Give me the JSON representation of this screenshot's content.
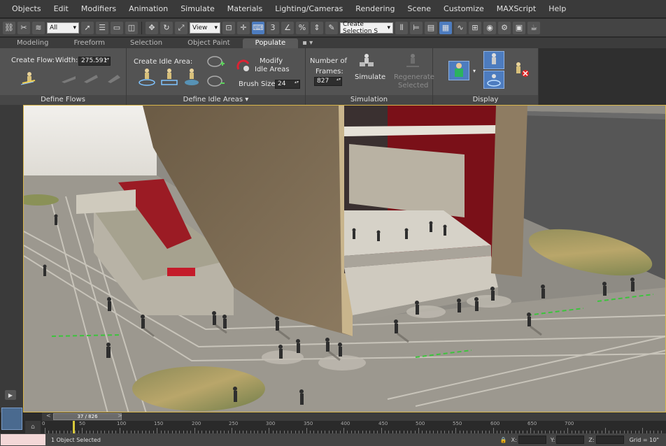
{
  "menu": [
    "Objects",
    "Edit",
    "Modifiers",
    "Animation",
    "Simulate",
    "Materials",
    "Lighting/Cameras",
    "Rendering",
    "Scene",
    "Customize",
    "MAXScript",
    "Help"
  ],
  "toolbar": {
    "filter_select": "All",
    "view_select": "View",
    "selection_set": "Create Selection S"
  },
  "ribbon_tabs": [
    "Modeling",
    "Freeform",
    "Selection",
    "Object Paint",
    "Populate"
  ],
  "ribbon": {
    "define_flows": {
      "create_flow_label": "Create Flow:",
      "width_label": "Width:",
      "width_value": "275.591",
      "footer": "Define Flows"
    },
    "define_idle_areas": {
      "create_idle_label": "Create Idle Area:",
      "modify_line1": "Modify",
      "modify_line2": "Idle Areas",
      "brush_size_label": "Brush Size:",
      "brush_size_value": "24",
      "footer": "Define Idle Areas"
    },
    "simulation": {
      "frames_line1": "Number of",
      "frames_line2": "Frames:",
      "frames_value": "827",
      "simulate_label": "Simulate",
      "regen_line1": "Regenerate",
      "regen_line2": "Selected",
      "footer": "Simulation"
    },
    "display": {
      "footer": "Display"
    }
  },
  "timeline": {
    "slider_text": "37 / 826",
    "ticks": [
      "0",
      "50",
      "100",
      "150",
      "200",
      "250",
      "300",
      "350",
      "400",
      "450",
      "500",
      "550",
      "600",
      "650",
      "700"
    ]
  },
  "status": {
    "selected_text": "1 Object Selected",
    "x_label": "X:",
    "y_label": "Y:",
    "z_label": "Z:",
    "grid_text": "Grid = 10\""
  },
  "colors": {
    "accent": "#4d7cbf",
    "viewport_border": "#d9b64a",
    "wall_red": "#8a1620",
    "ground": "#9a968e"
  }
}
